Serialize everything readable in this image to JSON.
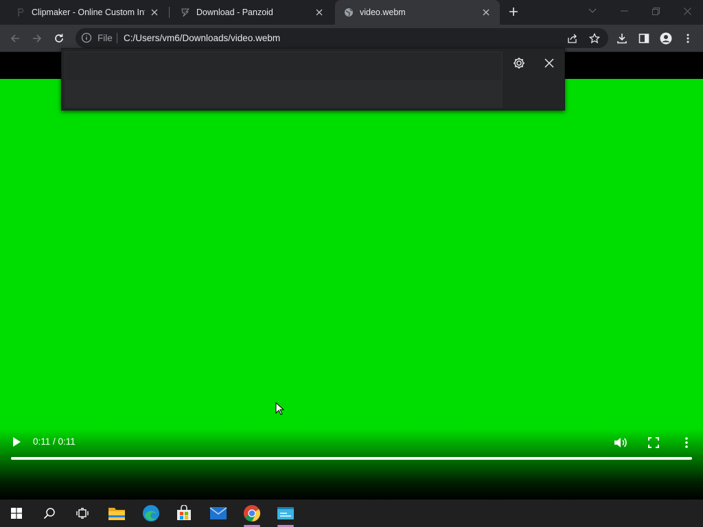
{
  "browser": {
    "tabs": [
      {
        "title": "Clipmaker - Online Custom Intro",
        "favicon": "panzoid-p-icon",
        "active": false
      },
      {
        "title": "Download - Panzoid",
        "favicon": "panzoid-logo-icon",
        "active": false
      },
      {
        "title": "video.webm",
        "favicon": "globe-icon",
        "active": true
      }
    ],
    "omnibox": {
      "scheme_label": "File",
      "url": "C:/Users/vm6/Downloads/video.webm"
    }
  },
  "video_player": {
    "time_display": "0:11 / 0:11",
    "progress": 1.0,
    "video_color": "#00dd00"
  },
  "taskbar": {
    "apps": [
      "start-icon",
      "search-icon",
      "task-view-icon",
      "file-explorer-icon",
      "edge-icon",
      "store-icon",
      "mail-icon",
      "chrome-icon",
      "app-icon"
    ],
    "indicator_color": "#c586c0"
  },
  "colors": {
    "tab_bg": "#202124",
    "toolbar_bg": "#35363a",
    "omnibox_bg": "#202124"
  }
}
